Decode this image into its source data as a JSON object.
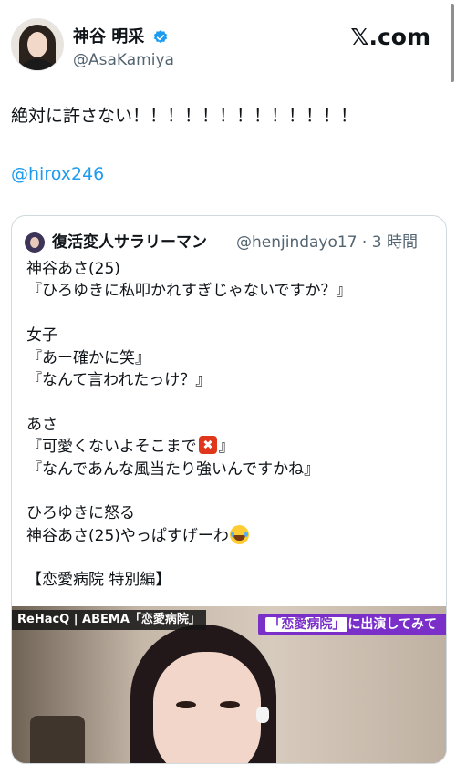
{
  "post": {
    "display_name": "神谷 明采",
    "handle": "@AsaKamiya",
    "brand": "𝕏.com",
    "text": "絶対に許さない！！！！！！！！！！！！！",
    "mention": "@hirox246"
  },
  "quote": {
    "author_name": "復活変人サラリーマン",
    "author_meta": "@henjindayo17 · 3 時間",
    "lines": [
      "神谷あさ(25)",
      "『ひろゆきに私叩かれすぎじゃないですか？』",
      "",
      "女子",
      "『あー確かに笑』",
      "『なんて言われたっけ？』",
      "",
      "あさ",
      "『可愛くないよそこまで",
      "』",
      "『なんであんな風当たり強いんですかね』",
      "",
      "ひろゆきに怒る",
      "神谷あさ(25)やっぱすげーわ",
      "",
      "【恋愛病院 特別編】"
    ],
    "media": {
      "tag_left": "ReHacQ | ABEMA「恋愛病院」",
      "tag_right_highlight": "「恋愛病院」",
      "tag_right_rest": "に出演してみて"
    }
  },
  "icons": {
    "verified": "verified-badge-icon",
    "angry": "anger-symbol-emoji",
    "laugh": "tears-of-joy-emoji"
  },
  "colors": {
    "accent": "#1d9bf0",
    "secondary_text": "#536471",
    "border": "#cfd9de",
    "purple_tag": "#7b2fc9"
  }
}
